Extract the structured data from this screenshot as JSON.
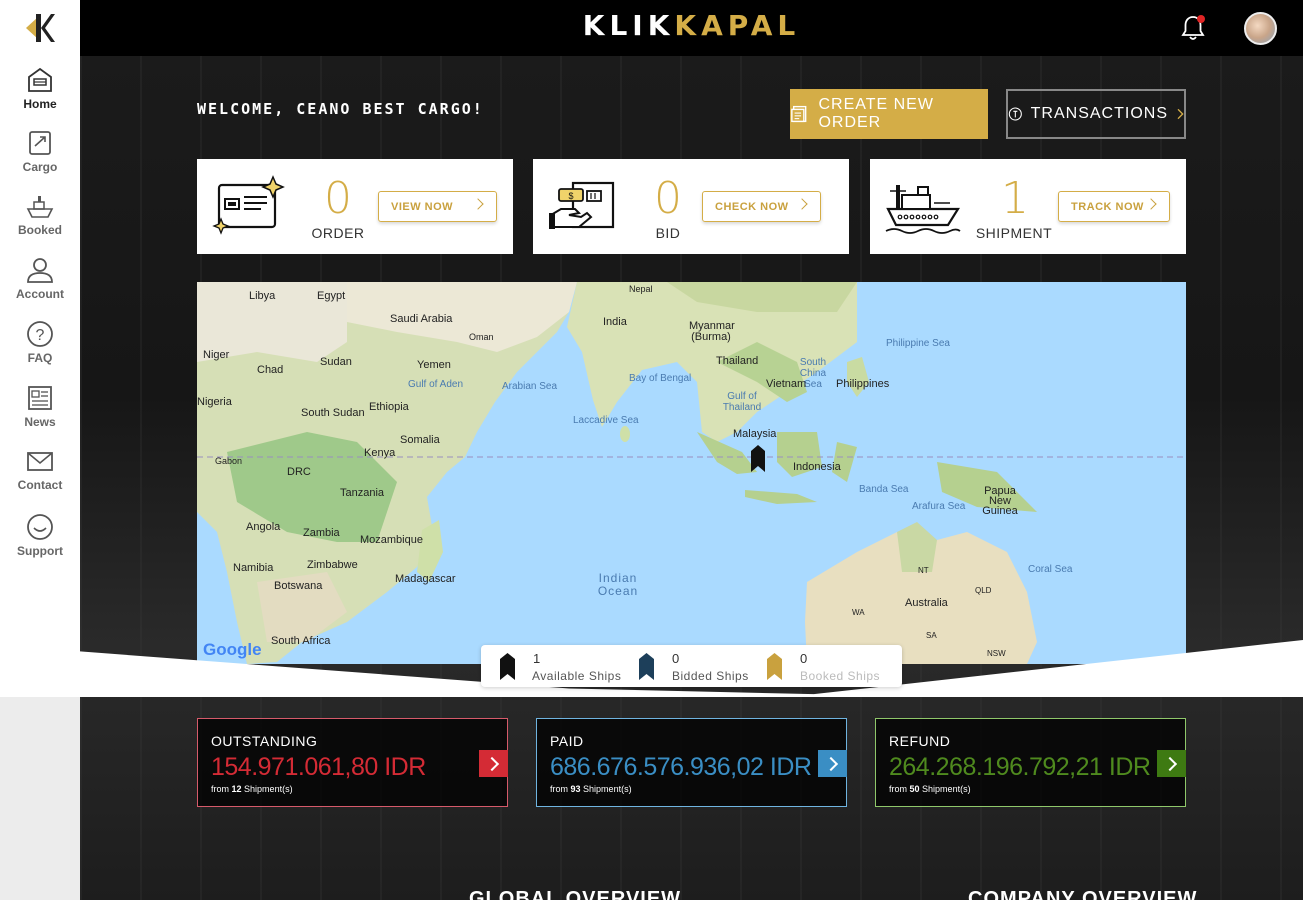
{
  "sidebar": {
    "items": [
      {
        "label": "Home",
        "icon": "home-icon"
      },
      {
        "label": "Cargo",
        "icon": "cargo-icon"
      },
      {
        "label": "Booked",
        "icon": "booked-icon"
      },
      {
        "label": "Account",
        "icon": "account-icon"
      },
      {
        "label": "FAQ",
        "icon": "faq-icon"
      },
      {
        "label": "News",
        "icon": "news-icon"
      },
      {
        "label": "Contact",
        "icon": "contact-icon"
      },
      {
        "label": "Support",
        "icon": "support-icon"
      }
    ]
  },
  "header": {
    "brand_part1": "KLIK",
    "brand_part2": "KAPAL",
    "notification_icon": "bell-icon"
  },
  "main": {
    "welcome": "WELCOME, CEANO BEST CARGO!",
    "create_order_label": "CREATE NEW ORDER",
    "transactions_label": "TRANSACTIONS",
    "cards": [
      {
        "count": "0",
        "label": "ORDER",
        "button": "VIEW NOW"
      },
      {
        "count": "0",
        "label": "BID",
        "button": "CHECK NOW"
      },
      {
        "count": "1",
        "label": "SHIPMENT",
        "button": "TRACK NOW"
      }
    ]
  },
  "map": {
    "labels": [
      "Libya",
      "Egypt",
      "Saudi Arabia",
      "Oman",
      "Nepal",
      "India",
      "Myanmar (Burma)",
      "Niger",
      "Chad",
      "Sudan",
      "Yemen",
      "Gulf of Aden",
      "Arabian Sea",
      "Bay of Bengal",
      "Thailand",
      "South China Sea",
      "Vietnam",
      "Philippines",
      "Philippine Sea",
      "Gulf of Thailand",
      "Nigeria",
      "South Sudan",
      "Ethiopia",
      "Laccadive Sea",
      "Malaysia",
      "Somalia",
      "Kenya",
      "Gabon",
      "DRC",
      "Indonesia",
      "Banda Sea",
      "Papua New Guinea",
      "Tanzania",
      "Arafura Sea",
      "Angola",
      "Zambia",
      "Mozambique",
      "Zimbabwe",
      "Namibia",
      "Botswana",
      "Madagascar",
      "Indian Ocean",
      "NT",
      "QLD",
      "Coral Sea",
      "WA",
      "Australia",
      "SA",
      "South Africa",
      "NSW"
    ],
    "google": "Google",
    "legend": [
      {
        "count": "1",
        "label": "Available Ships",
        "color": "#111111"
      },
      {
        "count": "0",
        "label": "Bidded Ships",
        "color": "#1d3f5a"
      },
      {
        "count": "0",
        "label": "Booked Ships",
        "color": "#c9a13e"
      }
    ]
  },
  "stats": [
    {
      "title": "OUTSTANDING",
      "amount": "154.971.061,80 IDR",
      "from": "from",
      "count": "12",
      "unit": "Shipment(s)",
      "color": "#d42b35"
    },
    {
      "title": "PAID",
      "amount": "686.676.576.936,02 IDR",
      "from": "from",
      "count": "93",
      "unit": "Shipment(s)",
      "color": "#3a8ec4"
    },
    {
      "title": "REFUND",
      "amount": "264.268.196.792,21 IDR",
      "from": "from",
      "count": "50",
      "unit": "Shipment(s)",
      "color": "#4f8a1e"
    }
  ],
  "overview": {
    "global": "GLOBAL OVERVIEW",
    "company": "COMPANY OVERVIEW"
  }
}
